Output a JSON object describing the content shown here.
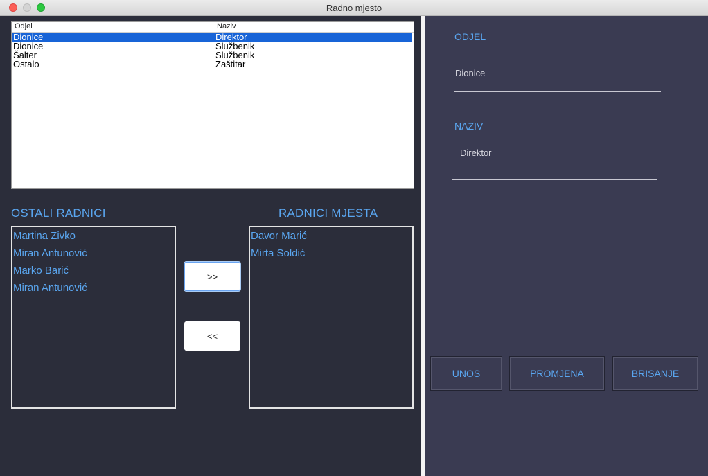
{
  "window": {
    "title": "Radno mjesto"
  },
  "table": {
    "headers": [
      "Odjel",
      "Naziv"
    ],
    "rows": [
      {
        "odjel": "Dionice",
        "naziv": "Direktor"
      },
      {
        "odjel": "Dionice",
        "naziv": "Službenik"
      },
      {
        "odjel": "Šalter",
        "naziv": "Službenik"
      },
      {
        "odjel": "Ostalo",
        "naziv": "Zaštitar"
      }
    ],
    "selected_index": 0
  },
  "ostali": {
    "label": "OSTALI RADNICI",
    "items": [
      "Martina Zivko",
      "Miran Antunović",
      "Marko Barić",
      "Miran Antunović"
    ]
  },
  "mjesta": {
    "label": "RADNICI MJESTA",
    "items": [
      "Davor Marić",
      "Mirta Soldić"
    ]
  },
  "buttons": {
    "add": ">>",
    "remove": "<<"
  },
  "form": {
    "odjel_label": "ODJEL",
    "odjel_value": "Dionice",
    "naziv_label": "NAZIV",
    "naziv_value": "Direktor"
  },
  "actions": {
    "unos": "UNOS",
    "promjena": "PROMJENA",
    "brisanje": "BRISANJE"
  },
  "colors": {
    "accent": "#5aa6f0",
    "left_bg": "#2b2d3a",
    "right_bg": "#3a3b52",
    "selection": "#1864d7"
  }
}
